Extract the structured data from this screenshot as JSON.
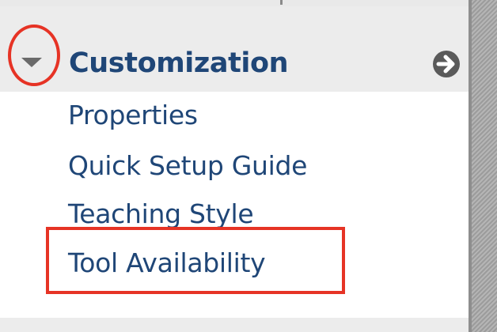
{
  "section": {
    "title": "Customization",
    "expanded": true,
    "toggle_icon": "caret-down-icon",
    "go_icon": "arrow-right-circle-icon"
  },
  "menu": {
    "items": [
      {
        "label": "Properties"
      },
      {
        "label": "Quick Setup Guide"
      },
      {
        "label": "Teaching Style"
      },
      {
        "label": "Tool Availability"
      }
    ]
  },
  "colors": {
    "link": "#1f4677",
    "header_bg": "#ececec",
    "highlight": "#e63325"
  }
}
